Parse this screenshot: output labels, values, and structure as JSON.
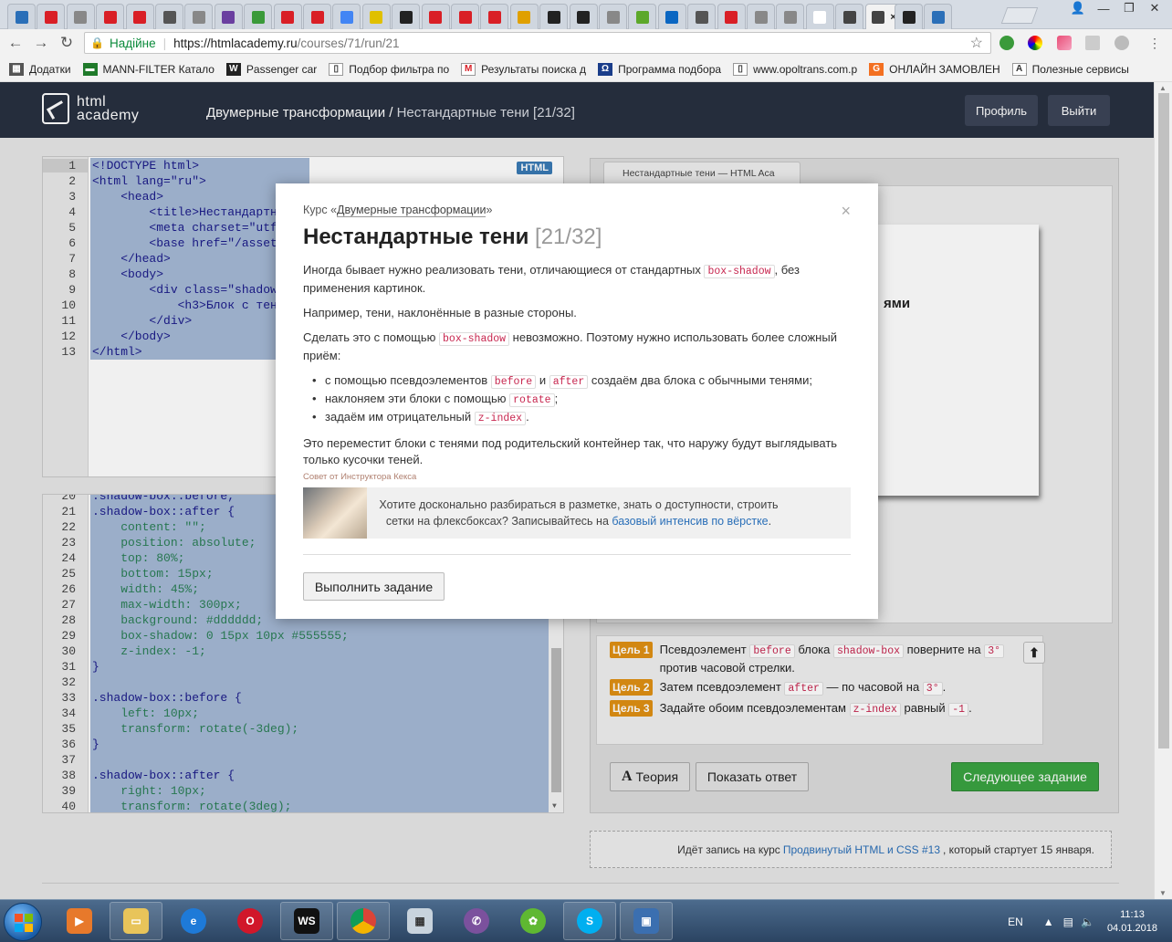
{
  "browser": {
    "tabs_count": 32,
    "address": {
      "secure_label": "Надійне",
      "url_host": "https://htmlacademy.ru",
      "url_path": "/courses/71/run/21"
    },
    "bookmarks": [
      {
        "label": "Додатки",
        "icon": "apps-icon"
      },
      {
        "label": "MANN-FILTER Катало",
        "icon": "mann-filter-icon"
      },
      {
        "label": "Passenger car",
        "icon": "wix-icon"
      },
      {
        "label": "Подбор фильтра по",
        "icon": "page-icon"
      },
      {
        "label": "Результаты поиска д",
        "icon": "m-icon"
      },
      {
        "label": "Программа подбора",
        "icon": "omega-icon"
      },
      {
        "label": "www.opoltrans.com.p",
        "icon": "page-icon"
      },
      {
        "label": "ОНЛАЙН ЗАМОВЛЕН",
        "icon": "g-icon"
      },
      {
        "label": "Полезные сервисы",
        "icon": "a-icon"
      }
    ]
  },
  "header": {
    "logo_line1": "html",
    "logo_line2": "academy",
    "breadcrumb_course": "Двумерные трансформации",
    "breadcrumb_sep": " / ",
    "breadcrumb_current": "Нестандартные тени",
    "breadcrumb_counter": "[21/32]",
    "profile_button": "Профиль",
    "logout_button": "Выйти"
  },
  "html_editor": {
    "badge": "HTML",
    "line_numbers": [
      "1",
      "2",
      "3",
      "4",
      "5",
      "6",
      "7",
      "8",
      "9",
      "10",
      "11",
      "12",
      "13"
    ],
    "lines": [
      "<!DOCTYPE html>",
      "<html lang=\"ru\">",
      "    <head>",
      "        <title>Нестандартн",
      "        <meta charset=\"utf",
      "        <base href=\"/asset",
      "    </head>",
      "    <body>",
      "        <div class=\"shadow",
      "            <h3>Блок с тен",
      "        </div>",
      "    </body>",
      "</html>"
    ]
  },
  "css_editor": {
    "line_numbers": [
      "20",
      "21",
      "22",
      "23",
      "24",
      "25",
      "26",
      "27",
      "28",
      "29",
      "30",
      "31",
      "32",
      "33",
      "34",
      "35",
      "36",
      "37",
      "38",
      "39",
      "40"
    ],
    "lines": [
      ".shadow-box::before,",
      ".shadow-box::after {",
      "    content: \"\";",
      "    position: absolute;",
      "    top: 80%;",
      "    bottom: 15px;",
      "    width: 45%;",
      "    max-width: 300px;",
      "    background: #dddddd;",
      "    box-shadow: 0 15px 10px #555555;",
      "    z-index: -1;",
      "}",
      "",
      ".shadow-box::before {",
      "    left: 10px;",
      "    transform: rotate(-3deg);",
      "}",
      "",
      ".shadow-box::after {",
      "    right: 10px;",
      "    transform: rotate(3deg);"
    ]
  },
  "preview": {
    "tab_title": "Нестандартные тени — HTML Aca",
    "card_title_fragment": "ями"
  },
  "goals": [
    {
      "badge": "Цель 1",
      "parts": [
        "Псевдоэлемент ",
        "before",
        " блока ",
        "shadow-box",
        " поверните на ",
        "3°",
        " против часовой стрелки."
      ]
    },
    {
      "badge": "Цель 2",
      "parts": [
        "Затем псевдоэлемент ",
        "after",
        " — по часовой на ",
        "3°",
        "."
      ]
    },
    {
      "badge": "Цель 3",
      "parts": [
        "Задайте обоим псевдоэлементам ",
        "z-index",
        " равный ",
        "-1",
        "."
      ]
    }
  ],
  "actions": {
    "theory_button": "Теория",
    "show_answer_button": "Показать ответ",
    "next_task_button": "Следующее задание"
  },
  "notice": {
    "prefix": "Идёт запись на курс",
    "link": "Продвинутый HTML и CSS #13",
    "suffix": ", который стартует 15 января."
  },
  "modal": {
    "course_prefix": "Курс «",
    "course_name": "Двумерные трансформации",
    "course_suffix": "»",
    "title": "Нестандартные тени",
    "counter": "[21/32]",
    "p1_before": "Иногда бывает нужно реализовать тени, отличающиеся от стандартных ",
    "p1_code": "box-shadow",
    "p1_after": ", без применения картинок.",
    "p2": "Например, тени, наклонённые в разные стороны.",
    "p3_before": "Сделать это с помощью ",
    "p3_code": "box-shadow",
    "p3_after": " невозможно. Поэтому нужно использовать более сложный приём:",
    "li1_a": "с помощью псевдоэлементов ",
    "li1_code1": "before",
    "li1_b": " и ",
    "li1_code2": "after",
    "li1_c": " создаём два блока с обычными тенями;",
    "li2_a": "наклоняем эти блоки с помощью ",
    "li2_code": "rotate",
    "li2_b": ";",
    "li3_a": "задаём им отрицательный ",
    "li3_code": "z-index",
    "li3_b": ".",
    "p4": "Это переместит блоки с тенями под родительский контейнер так, что наружу будут выглядывать только кусочки теней.",
    "tip_label": "Совет от Инструктора Кекса",
    "tip_text": "Хотите досконально разбираться в разметке, знать о доступности, строить сетки на флексбоксах? Записывайтесь на ",
    "tip_link": "базовый интенсив по вёрстке",
    "tip_end": ".",
    "do_task_button": "Выполнить задание"
  },
  "taskbar": {
    "lang": "EN",
    "time": "11:13",
    "date": "04.01.2018"
  }
}
